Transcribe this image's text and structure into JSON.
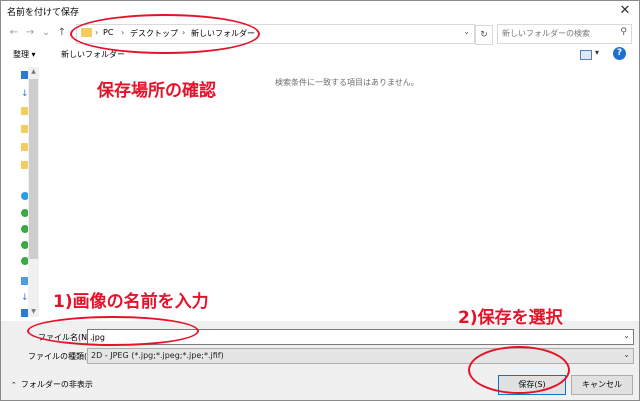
{
  "window": {
    "title": "名前を付けて保存",
    "close_glyph": "✕"
  },
  "address_bar": {
    "crumbs": [
      "PC",
      "デスクトップ",
      "新しいフォルダー"
    ]
  },
  "search": {
    "placeholder": "新しいフォルダーの検索"
  },
  "toolbar": {
    "organize": "整理 ▾",
    "new_folder": "新しいフォルダー"
  },
  "content": {
    "empty_message": "検索条件に一致する項目はありません。"
  },
  "form": {
    "filename_label": "ファイル名(N):",
    "filename_value": ".jpg",
    "filetype_label": "ファイルの種類(T):",
    "filetype_value": "2D - JPEG (*.jpg;*.jpeg;*.jpe;*.jfif)"
  },
  "footer": {
    "hide_folders": "フォルダーの非表示",
    "save_label": "保存(S)",
    "cancel_label": "キャンセル"
  },
  "annotations": {
    "location": "保存場所の確認",
    "step1": "1)画像の名前を入力",
    "step2": "2)保存を選択",
    "color": "#e5132a"
  }
}
